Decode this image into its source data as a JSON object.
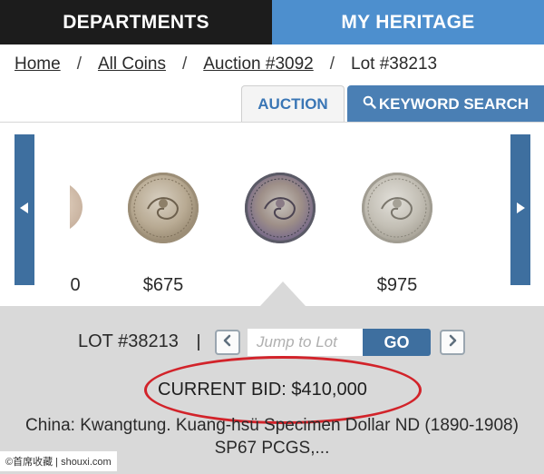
{
  "topnav": {
    "departments_label": "DEPARTMENTS",
    "my_heritage_label": "MY HERITAGE",
    "dark_color": "#1c1c1c",
    "blue_color": "#4d8fce"
  },
  "breadcrumb": {
    "items": [
      "Home",
      "All Coins",
      "Auction #3092",
      "Lot #38213"
    ],
    "separator": "/"
  },
  "tabs": {
    "auction_label": "AUCTION",
    "keyword_label": "KEYWORD SEARCH",
    "keyword_icon": "search-icon"
  },
  "carousel": {
    "left_arrow_icon": "triangle-left-icon",
    "right_arrow_icon": "triangle-right-icon",
    "items": [
      {
        "price": "0"
      },
      {
        "price": "$675"
      },
      {
        "price": ""
      },
      {
        "price": "$975"
      }
    ]
  },
  "lot_panel": {
    "lot_label": "LOT #38213",
    "jump_placeholder": "Jump to Lot",
    "go_label": "GO",
    "current_bid": "CURRENT BID: $410,000",
    "highlight_color": "#d2232a",
    "title": "China: Kwangtung. Kuang-hsü Specimen Dollar ND (1890-1908) SP67 PCGS,..."
  },
  "watermark": "©首席收藏 | shouxi.com"
}
